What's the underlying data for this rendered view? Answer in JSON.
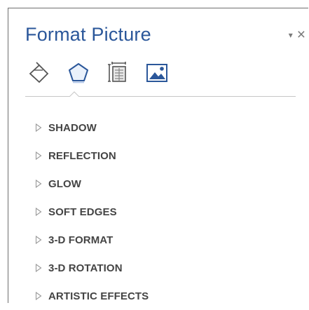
{
  "pane": {
    "title": "Format Picture",
    "controls": {
      "dropdown_glyph": "▾",
      "close_glyph": "×"
    }
  },
  "tabs": [
    {
      "icon": "fill-line-icon",
      "selected": false
    },
    {
      "icon": "effects-pentagon-icon",
      "selected": true
    },
    {
      "icon": "size-properties-icon",
      "selected": false
    },
    {
      "icon": "picture-icon",
      "selected": false
    }
  ],
  "sections": [
    {
      "label": "SHADOW"
    },
    {
      "label": "REFLECTION"
    },
    {
      "label": "GLOW"
    },
    {
      "label": "SOFT EDGES"
    },
    {
      "label": "3-D FORMAT"
    },
    {
      "label": "3-D ROTATION"
    },
    {
      "label": "ARTISTIC EFFECTS"
    }
  ],
  "colors": {
    "title": "#2b579a",
    "accent": "#2b579a",
    "label": "#444444",
    "border": "#6f6f6f"
  }
}
